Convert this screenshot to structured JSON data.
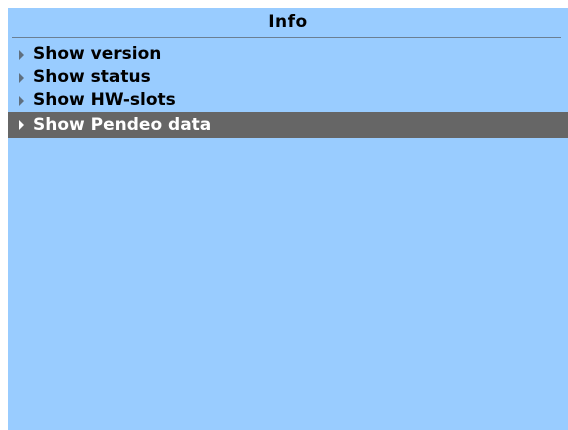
{
  "screen": {
    "title": "Info",
    "background": "#99ccff",
    "selected_background": "#666666"
  },
  "menu": {
    "items": [
      {
        "label": "Show version",
        "icon": "triangle-right-icon",
        "selected": false
      },
      {
        "label": "Show status",
        "icon": "triangle-right-icon",
        "selected": false
      },
      {
        "label": "Show HW-slots",
        "icon": "triangle-right-icon",
        "selected": false
      },
      {
        "label": "Show Pendeo data",
        "icon": "triangle-right-icon",
        "selected": true
      }
    ]
  }
}
